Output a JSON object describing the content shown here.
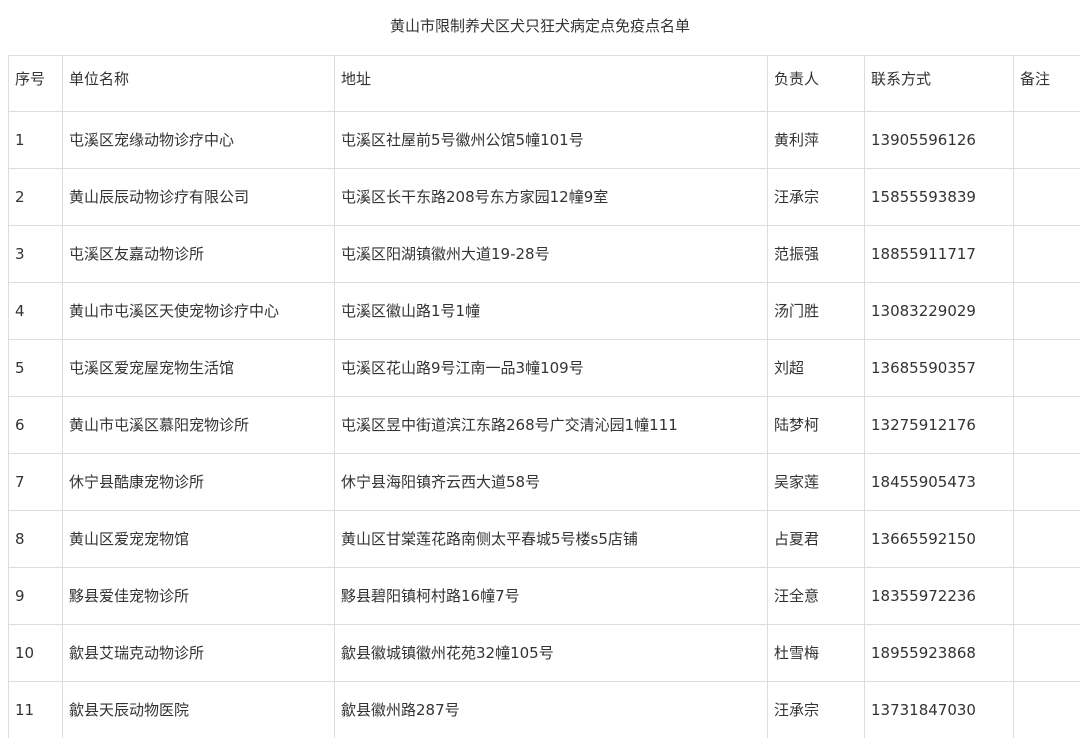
{
  "title": "黄山市限制养犬区犬只狂犬病定点免疫点名单",
  "table": {
    "headers": [
      "序号",
      "单位名称",
      "地址",
      "负责人",
      "联系方式",
      "备注"
    ],
    "rows": [
      [
        "1",
        "屯溪区宠缘动物诊疗中心",
        "屯溪区社屋前5号徽州公馆5幢101号",
        "黄利萍",
        "13905596126",
        ""
      ],
      [
        "2",
        "黄山辰辰动物诊疗有限公司",
        "屯溪区长干东路208号东方家园12幢9室",
        "汪承宗",
        "15855593839",
        ""
      ],
      [
        "3",
        "屯溪区友嘉动物诊所",
        "屯溪区阳湖镇徽州大道19-28号",
        "范振强",
        "18855911717",
        ""
      ],
      [
        "4",
        "黄山市屯溪区天使宠物诊疗中心",
        "屯溪区徽山路1号1幢",
        "汤门胜",
        "13083229029",
        ""
      ],
      [
        "5",
        "屯溪区爱宠屋宠物生活馆",
        "屯溪区花山路9号江南一品3幢109号",
        "刘超",
        "13685590357",
        ""
      ],
      [
        "6",
        "黄山市屯溪区慕阳宠物诊所",
        "屯溪区昱中街道滨江东路268号广交清沁园1幢111",
        "陆梦柯",
        "13275912176",
        ""
      ],
      [
        "7",
        "休宁县酷康宠物诊所",
        "休宁县海阳镇齐云西大道58号",
        "吴家莲",
        "18455905473",
        ""
      ],
      [
        "8",
        "黄山区爱宠宠物馆",
        "黄山区甘棠莲花路南侧太平春城5号楼s5店铺",
        "占夏君",
        "13665592150",
        ""
      ],
      [
        "9",
        "黟县爱佳宠物诊所",
        "黟县碧阳镇柯村路16幢7号",
        "汪全意",
        "18355972236",
        ""
      ],
      [
        "10",
        "歙县艾瑞克动物诊所",
        "歙县徽城镇徽州花苑32幢105号",
        "杜雪梅",
        "18955923868",
        ""
      ],
      [
        "11",
        "歙县天辰动物医院",
        "歙县徽州路287号",
        "汪承宗",
        "13731847030",
        ""
      ]
    ]
  }
}
